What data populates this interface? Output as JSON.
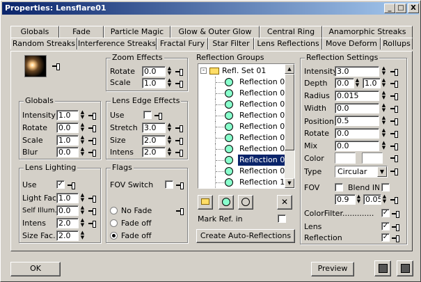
{
  "window": {
    "title": "Properties: Lensflare01",
    "min": "_",
    "max": "□",
    "close": "X"
  },
  "tabs_row1": [
    "Globals",
    "Fade",
    "Particle Magic",
    "Glow & Outer Glow",
    "Central Ring",
    "Anamorphic Streaks"
  ],
  "tabs_row2": [
    "Random Streaks",
    "Interference Streaks",
    "Fractal Fury",
    "Star Filter",
    "Lens Reflections",
    "Move Deform",
    "Rollups"
  ],
  "zoom": {
    "title": "Zoom Effects",
    "rotate_label": "Rotate",
    "rotate": "0.0",
    "scale_label": "Scale",
    "scale": "1.0"
  },
  "globals": {
    "title": "Globals",
    "intensity_label": "Intensity",
    "intensity": "1.0",
    "rotate_label": "Rotate",
    "rotate": "0.0",
    "scale_label": "Scale",
    "scale": "1.0",
    "blur_label": "Blur",
    "blur": "0.0"
  },
  "lens_edge": {
    "title": "Lens Edge Effects",
    "use_label": "Use",
    "stretch_label": "Stretch",
    "stretch": "3.0",
    "size_label": "Size",
    "size": "2.0",
    "intens_label": "Intens",
    "intens": "2.0"
  },
  "lens_lighting": {
    "title": "Lens Lighting",
    "use_label": "Use",
    "use_checked": "✓",
    "lightfac_label": "Light Fac.",
    "lightfac": "1.0",
    "selfillum_label": "Self Illum.",
    "selfillum": "0.0",
    "intens_label": "Intens",
    "intens": "2.0",
    "sizefac_label": "Size Fac.",
    "sizefac": "2.0"
  },
  "flags": {
    "title": "Flags",
    "fov_label": "FOV Switch",
    "nofade": "No Fade",
    "fadeoff1": "Fade off",
    "fadeoff2": "Fade off"
  },
  "refl_groups": {
    "title": "Reflection Groups",
    "set": "Refl. Set 01",
    "items": [
      "Reflection 01",
      "Reflection 02",
      "Reflection 03",
      "Reflection 04",
      "Reflection 05",
      "Reflection 06",
      "Reflection 07",
      "Reflection 08",
      "Reflection 09",
      "Reflection 10"
    ],
    "selected_index": 7,
    "mark_label": "Mark Ref. in",
    "create_label": "Create Auto-Reflections"
  },
  "refl_settings": {
    "title": "Reflection Settings",
    "intensity_label": "Intensity",
    "intensity": "3.0",
    "depth_label": "Depth",
    "depth1": "0.0",
    "depth2": "1.0",
    "radius_label": "Radius",
    "radius": "0.015",
    "width_label": "Width",
    "width": "0.0",
    "position_label": "Position",
    "position": "0.5",
    "rotate_label": "Rotate",
    "rotate": "0.0",
    "mix_label": "Mix",
    "mix": "0.0",
    "color_label": "Color",
    "type_label": "Type",
    "type_value": "Circular",
    "fov_label": "FOV",
    "blend_label": "Blend IN",
    "fov1": "0.9",
    "fov2": "0.05",
    "colorfilter_label": "ColorFilter.............",
    "lens_label": "Lens",
    "reflection_label": "Reflection",
    "check": "✓"
  },
  "footer": {
    "ok": "OK",
    "preview": "Preview"
  }
}
